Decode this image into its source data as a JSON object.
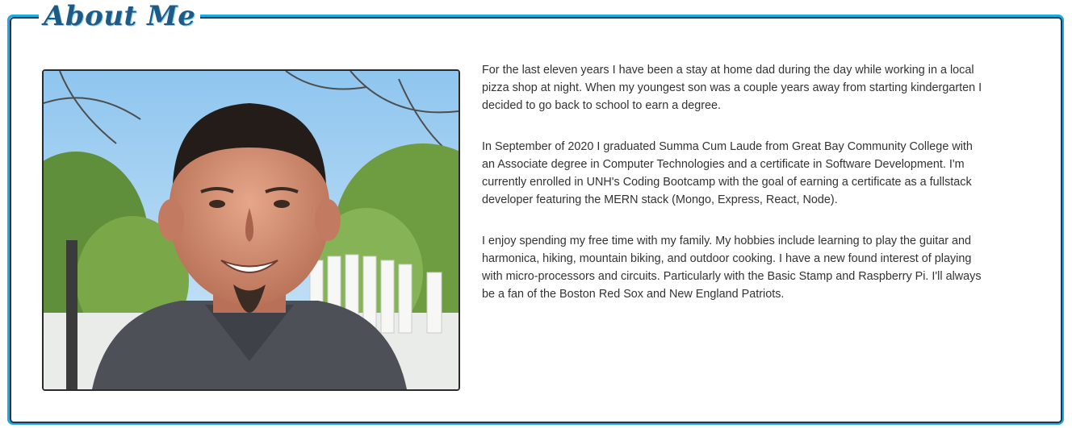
{
  "about": {
    "title": "About Me",
    "photo_alt": "Portrait photo",
    "paragraphs": [
      "For the last eleven years I have been a stay at home dad during the day while working in a local pizza shop at night. When my youngest son was a couple years away from starting kindergarten I decided to go back to school to earn a degree.",
      "In September of 2020 I graduated Summa Cum Laude from Great Bay Community College with an Associate degree in Computer Technologies and a certificate in Software Development. I'm currently enrolled in UNH's Coding Bootcamp with the goal of earning a certificate as a fullstack developer featuring the MERN stack (Mongo, Express, React, Node).",
      "I enjoy spending my free time with my family. My hobbies include learning to play the guitar and harmonica, hiking, mountain biking, and outdoor cooking. I have a new found interest of playing with micro-processors and circuits. Particularly with the Basic Stamp and Raspberry Pi. I'll always be a fan of the Boston Red Sox and New England Patriots."
    ]
  },
  "colors": {
    "frame_blue": "#21a9e1",
    "frame_dark": "#1f3550",
    "heading": "#1f5a86",
    "body_text": "#333333"
  }
}
